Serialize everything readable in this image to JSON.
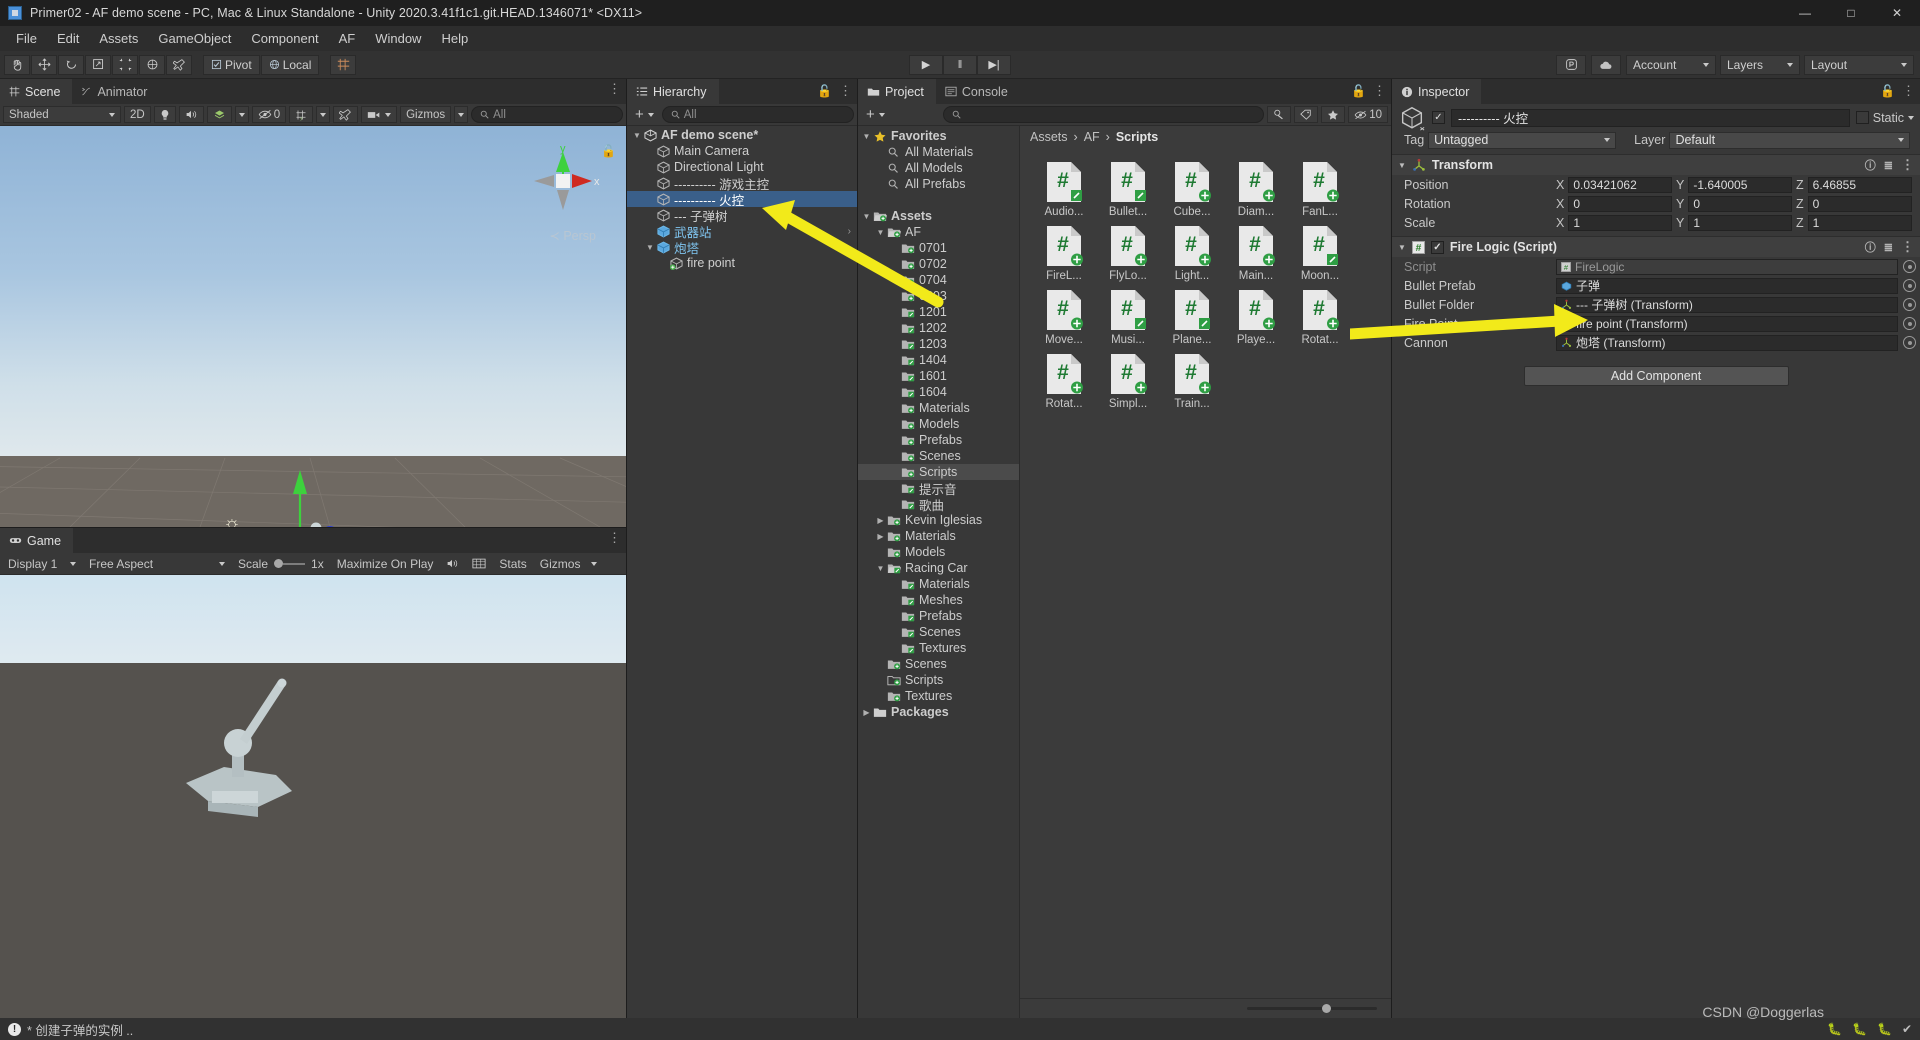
{
  "window": {
    "title": "Primer02 - AF demo scene - PC, Mac & Linux Standalone - Unity 2020.3.41f1c1.git.HEAD.1346071* <DX11>",
    "minimize": "—",
    "maximize": "□",
    "close": "✕"
  },
  "menu": {
    "items": [
      "File",
      "Edit",
      "Assets",
      "GameObject",
      "Component",
      "AF",
      "Window",
      "Help"
    ]
  },
  "toolbar": {
    "tools": [
      "hand-tool",
      "move-tool",
      "rotate-tool",
      "scale-tool",
      "rect-tool",
      "transform-tool",
      "custom-tool"
    ],
    "pivot_label": "Pivot",
    "local_label": "Local",
    "grid_label": "#",
    "play": "▶",
    "pause": "‖",
    "step": "▶|",
    "collab_label": "collab-icon",
    "cloud_label": "cloud-icon",
    "account_label": "Account",
    "layers_label": "Layers",
    "layout_label": "Layout"
  },
  "scene": {
    "tabs": [
      {
        "label": "Scene",
        "icon": "scene-icon",
        "active": true
      },
      {
        "label": "Animator",
        "icon": "animator-icon",
        "active": false
      }
    ],
    "shading_mode": "Shaded",
    "mode_2d": "2D",
    "light_icon": "lighting-icon",
    "audio_icon": "audio-icon",
    "fx_icon": "effects-icon",
    "hidden_count": "0",
    "grid_icon": "grid-visibility-icon",
    "tool_icon": "scene-tools-icon",
    "camera_icon": "scene-camera-icon",
    "gizmos_label": "Gizmos",
    "search_placeholder": "All",
    "persp_label": "Persp",
    "axis_y": "y",
    "axis_x": "x"
  },
  "game": {
    "tab_label": "Game",
    "display": "Display 1",
    "aspect": "Free Aspect",
    "scale_label": "Scale",
    "scale_value": "1x",
    "maximize_label": "Maximize On Play",
    "mute_icon": "mute-audio-icon",
    "stats_label": "Stats",
    "gizmos_label": "Gizmos"
  },
  "hierarchy": {
    "tab_label": "Hierarchy",
    "add_label": "+",
    "search_placeholder": "All",
    "items": [
      {
        "label": "AF demo scene*",
        "depth": 0,
        "icon": "scene-icon",
        "twirl": "▼",
        "selected": false,
        "bold": true
      },
      {
        "label": "Main Camera",
        "depth": 1,
        "icon": "gameobject-icon",
        "twirl": "",
        "selected": false
      },
      {
        "label": "Directional Light",
        "depth": 1,
        "icon": "gameobject-icon",
        "twirl": "",
        "selected": false
      },
      {
        "label": "---------- 游戏主控",
        "depth": 1,
        "icon": "gameobject-icon",
        "twirl": "",
        "selected": false
      },
      {
        "label": "---------- 火控",
        "depth": 1,
        "icon": "gameobject-icon",
        "twirl": "",
        "selected": true
      },
      {
        "label": "--- 子弹树",
        "depth": 1,
        "icon": "gameobject-icon",
        "twirl": "",
        "selected": false
      },
      {
        "label": "武器站",
        "depth": 1,
        "icon": "prefab-icon",
        "twirl": "",
        "selected": false,
        "chevron": "›"
      },
      {
        "label": "炮塔",
        "depth": 1,
        "icon": "prefab-icon",
        "twirl": "▼",
        "selected": false,
        "chevron": "›"
      },
      {
        "label": "fire point",
        "depth": 2,
        "icon": "gameobject-add-icon",
        "twirl": "",
        "selected": false
      }
    ]
  },
  "project": {
    "tabs": [
      {
        "label": "Project",
        "icon": "folder-icon",
        "active": true
      },
      {
        "label": "Console",
        "icon": "console-icon",
        "active": false
      }
    ],
    "add_label": "+",
    "search_placeholder": "",
    "filter_icons": [
      "type-filter-icon",
      "label-filter-icon",
      "favorite-filter-icon"
    ],
    "hidden_count": "10",
    "tree": [
      {
        "label": "Favorites",
        "depth": 0,
        "twirl": "▼",
        "icon": "star-icon",
        "bold": true
      },
      {
        "label": "All Materials",
        "depth": 1,
        "twirl": "",
        "icon": "search-icon"
      },
      {
        "label": "All Models",
        "depth": 1,
        "twirl": "",
        "icon": "search-icon"
      },
      {
        "label": "All Prefabs",
        "depth": 1,
        "twirl": "",
        "icon": "search-icon"
      },
      {
        "label": "",
        "depth": 0,
        "twirl": "",
        "icon": "spacer"
      },
      {
        "label": "Assets",
        "depth": 0,
        "twirl": "▼",
        "icon": "folder-open-plus-icon",
        "bold": true
      },
      {
        "label": "AF",
        "depth": 1,
        "twirl": "▼",
        "icon": "folder-open-plus-icon"
      },
      {
        "label": "0701",
        "depth": 2,
        "twirl": "",
        "icon": "folder-plus-icon"
      },
      {
        "label": "0702",
        "depth": 2,
        "twirl": "",
        "icon": "folder-plus-icon"
      },
      {
        "label": "0704",
        "depth": 2,
        "twirl": "",
        "icon": "folder-plus-icon"
      },
      {
        "label": "0803",
        "depth": 2,
        "twirl": "",
        "icon": "folder-plus-icon"
      },
      {
        "label": "1201",
        "depth": 2,
        "twirl": "",
        "icon": "folder-edit-icon"
      },
      {
        "label": "1202",
        "depth": 2,
        "twirl": "",
        "icon": "folder-edit-icon"
      },
      {
        "label": "1203",
        "depth": 2,
        "twirl": "",
        "icon": "folder-edit-icon"
      },
      {
        "label": "1404",
        "depth": 2,
        "twirl": "",
        "icon": "folder-edit-icon"
      },
      {
        "label": "1601",
        "depth": 2,
        "twirl": "",
        "icon": "folder-edit-icon"
      },
      {
        "label": "1604",
        "depth": 2,
        "twirl": "",
        "icon": "folder-edit-icon"
      },
      {
        "label": "Materials",
        "depth": 2,
        "twirl": "",
        "icon": "folder-plus-icon"
      },
      {
        "label": "Models",
        "depth": 2,
        "twirl": "",
        "icon": "folder-plus-icon"
      },
      {
        "label": "Prefabs",
        "depth": 2,
        "twirl": "",
        "icon": "folder-plus-icon"
      },
      {
        "label": "Scenes",
        "depth": 2,
        "twirl": "",
        "icon": "folder-plus-icon"
      },
      {
        "label": "Scripts",
        "depth": 2,
        "twirl": "",
        "icon": "folder-plus-icon",
        "selected": true
      },
      {
        "label": "提示音",
        "depth": 2,
        "twirl": "",
        "icon": "folder-edit-icon"
      },
      {
        "label": "歌曲",
        "depth": 2,
        "twirl": "",
        "icon": "folder-edit-icon"
      },
      {
        "label": "Kevin Iglesias",
        "depth": 1,
        "twirl": "▶",
        "icon": "folder-plus-icon"
      },
      {
        "label": "Materials",
        "depth": 1,
        "twirl": "▶",
        "icon": "folder-plus-icon"
      },
      {
        "label": "Models",
        "depth": 1,
        "twirl": "",
        "icon": "folder-plus-icon"
      },
      {
        "label": "Racing Car",
        "depth": 1,
        "twirl": "▼",
        "icon": "folder-open-edit-icon"
      },
      {
        "label": "Materials",
        "depth": 2,
        "twirl": "",
        "icon": "folder-edit-icon"
      },
      {
        "label": "Meshes",
        "depth": 2,
        "twirl": "",
        "icon": "folder-edit-icon"
      },
      {
        "label": "Prefabs",
        "depth": 2,
        "twirl": "",
        "icon": "folder-edit-icon"
      },
      {
        "label": "Scenes",
        "depth": 2,
        "twirl": "",
        "icon": "folder-edit-icon"
      },
      {
        "label": "Textures",
        "depth": 2,
        "twirl": "",
        "icon": "folder-edit-icon"
      },
      {
        "label": "Scenes",
        "depth": 1,
        "twirl": "",
        "icon": "folder-plus-icon"
      },
      {
        "label": "Scripts",
        "depth": 1,
        "twirl": "",
        "icon": "folder-outline-plus-icon"
      },
      {
        "label": "Textures",
        "depth": 1,
        "twirl": "",
        "icon": "folder-plus-icon"
      },
      {
        "label": "Packages",
        "depth": 0,
        "twirl": "▶",
        "icon": "folder-plain-icon",
        "bold": true
      }
    ],
    "breadcrumb": {
      "root": "Assets",
      "mid": "AF",
      "leaf": "Scripts",
      "sep": "›"
    },
    "assets": [
      {
        "label": "Audio...",
        "badge": "edit"
      },
      {
        "label": "Bullet...",
        "badge": "edit"
      },
      {
        "label": "Cube...",
        "badge": "plus"
      },
      {
        "label": "Diam...",
        "badge": "plus"
      },
      {
        "label": "FanL...",
        "badge": "plus"
      },
      {
        "label": "FireL...",
        "badge": "plus"
      },
      {
        "label": "FlyLo...",
        "badge": "plus"
      },
      {
        "label": "Light...",
        "badge": "plus"
      },
      {
        "label": "Main...",
        "badge": "plus"
      },
      {
        "label": "Moon...",
        "badge": "edit"
      },
      {
        "label": "Move...",
        "badge": "plus"
      },
      {
        "label": "Musi...",
        "badge": "edit"
      },
      {
        "label": "Plane...",
        "badge": "edit"
      },
      {
        "label": "Playe...",
        "badge": "plus"
      },
      {
        "label": "Rotat...",
        "badge": "plus"
      },
      {
        "label": "Rotat...",
        "badge": "plus"
      },
      {
        "label": "Simpl...",
        "badge": "plus"
      },
      {
        "label": "Train...",
        "badge": "plus"
      }
    ]
  },
  "inspector": {
    "tab_label": "Inspector",
    "object_name": "---------- 火控",
    "enabled": true,
    "static_label": "Static",
    "tag_label": "Tag",
    "tag_value": "Untagged",
    "layer_label": "Layer",
    "layer_value": "Default",
    "transform": {
      "title": "Transform",
      "rows": [
        {
          "label": "Position",
          "x": "0.03421062",
          "y": "-1.640005",
          "z": "6.46855"
        },
        {
          "label": "Rotation",
          "x": "0",
          "y": "0",
          "z": "0"
        },
        {
          "label": "Scale",
          "x": "1",
          "y": "1",
          "z": "1"
        }
      ]
    },
    "fire_logic": {
      "title": "Fire Logic (Script)",
      "enabled": true,
      "fields": [
        {
          "label": "Script",
          "value": "FireLogic",
          "icon": "script-icon",
          "readonly": true
        },
        {
          "label": "Bullet Prefab",
          "value": "子弹",
          "icon": "prefab-icon",
          "readonly": false
        },
        {
          "label": "Bullet Folder",
          "value": "--- 子弹树 (Transform)",
          "icon": "transform-icon",
          "readonly": false
        },
        {
          "label": "Fire Point",
          "value": "fire point (Transform)",
          "icon": "transform-icon",
          "readonly": false
        },
        {
          "label": "Cannon",
          "value": "炮塔 (Transform)",
          "icon": "transform-icon",
          "readonly": false
        }
      ]
    },
    "add_component_label": "Add Component"
  },
  "status": {
    "message": "* 创建子弹的实例 ..",
    "watermark": "CSDN @Doggerlas"
  },
  "colors": {
    "selection_blue": "#3a5f8a",
    "arrow_yellow": "#f2ea1a",
    "accent_green": "#4caf50",
    "panel_bg": "#383838"
  }
}
